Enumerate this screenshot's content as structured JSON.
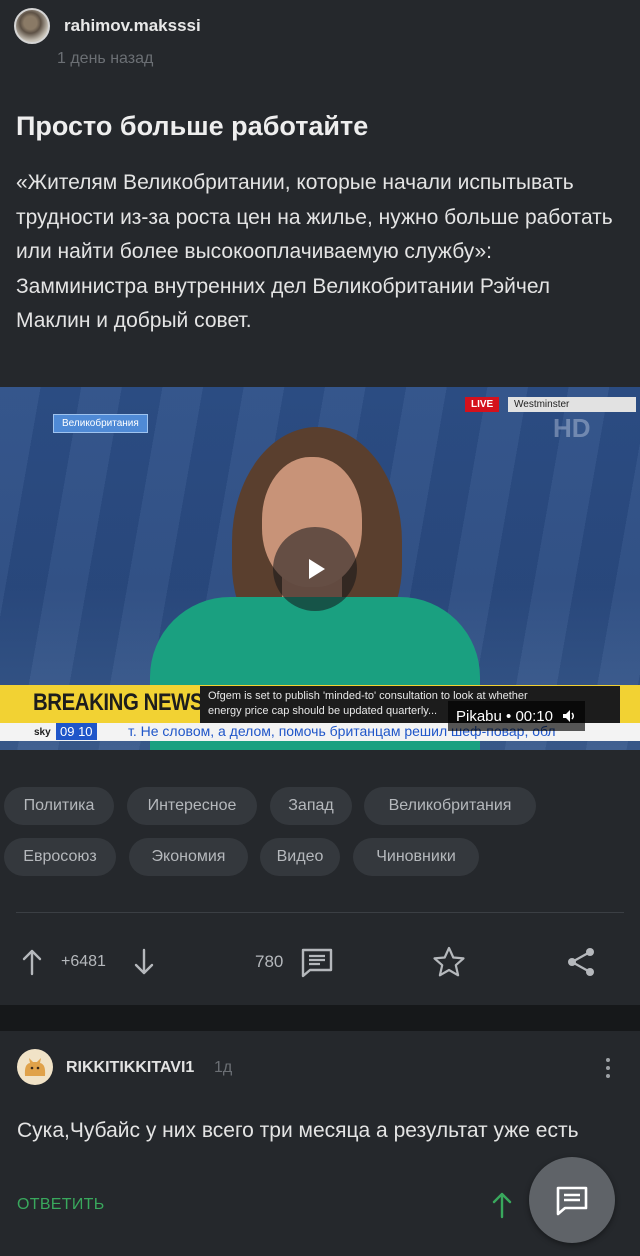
{
  "post": {
    "author": "rahimov.maksssi",
    "time": "1 день назад",
    "title": "Просто больше работайте",
    "text": "«Жителям Великобритании, которые начали испытывать трудности из-за роста цен на жилье, нужно больше работать или найти более высокооплачиваемую службу»: Замминистра внутренних дел Великобритании Рэйчел Маклин и добрый совет."
  },
  "video": {
    "country_label": "Великобритания",
    "live_label": "LIVE",
    "location_label": "Westminster",
    "channel_watermark": "HD",
    "ticker_title": "BREAKING NEWS",
    "ticker_line1": "Ofgem is set to publish 'minded-to' consultation to look at whether",
    "ticker_line2": "energy price cap should be updated quarterly...",
    "crawl_time": "09 10",
    "crawl_text": "т.   Не словом, а делом, помочь британцам решил шеф-повар, обл",
    "sky_logo": "sky",
    "source_badge": "Pikabu • 00:10",
    "colors": {
      "ticker_yellow": "#f2d233",
      "crawl_blue": "#1f56c9",
      "live_red": "#d4111c"
    }
  },
  "tags": [
    "Политика",
    "Интересное",
    "Запад",
    "Великобритания",
    "Евросоюз",
    "Экономия",
    "Видео",
    "Чиновники"
  ],
  "actions": {
    "rating": "+6481",
    "comments": "780"
  },
  "comment": {
    "author": "RIKKITIKKITAVI1",
    "time": "1д",
    "text": "Сука,Чубайс у них всего три месяца а результат уже есть",
    "reply_label": "ОТВЕТИТЬ"
  },
  "theme": {
    "background": "#25282c",
    "separator": "#16181a",
    "tag_bg": "#34383d",
    "accent_green": "#39a85d"
  }
}
